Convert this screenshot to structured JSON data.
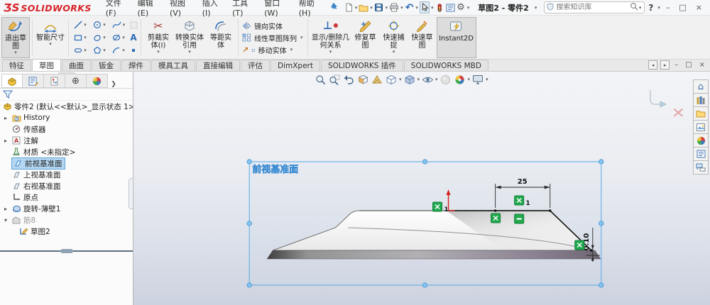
{
  "titlebar": {
    "logo_mark": "ƷS",
    "logo_text": "SOLIDWORKS",
    "menus": [
      {
        "label": "文件(F)"
      },
      {
        "label": "编辑(E)"
      },
      {
        "label": "视图(V)"
      },
      {
        "label": "插入(I)"
      },
      {
        "label": "工具(T)"
      },
      {
        "label": "窗口(W)"
      },
      {
        "label": "帮助(H)"
      }
    ],
    "doc_title": "草图2 - 零件2",
    "search_placeholder": "搜索知识库",
    "help_label": "?",
    "win": {
      "min": "–",
      "max": "□",
      "close": "×"
    }
  },
  "ribbon": {
    "exit_sketch": "退出草图",
    "smart_dimension": "智能尺寸",
    "text_tool": "A",
    "trim": "剪裁实体(I)",
    "convert": "转换实体引用",
    "offset": "等距实体",
    "mirror": "镜向实体",
    "linear_pattern": "线性草图阵列",
    "move": "移动实体",
    "relations": "显示/删除几何关系",
    "repair": "修复草图",
    "quick_snaps": "快速捕捉",
    "rapid_sketch": "快速草图",
    "instant2d": "Instant2D"
  },
  "tabs": [
    {
      "label": "特征"
    },
    {
      "label": "草图"
    },
    {
      "label": "曲面"
    },
    {
      "label": "钣金"
    },
    {
      "label": "焊件"
    },
    {
      "label": "模具工具"
    },
    {
      "label": "直接编辑"
    },
    {
      "label": "评估"
    },
    {
      "label": "DimXpert"
    },
    {
      "label": "SOLIDWORKS 插件"
    },
    {
      "label": "SOLIDWORKS MBD"
    }
  ],
  "docwin": {
    "prev": "◂",
    "next": "▸",
    "min": "–",
    "max": "□",
    "close": "×"
  },
  "tree": {
    "root": "零件2 (默认<<默认>_显示状态 1>)",
    "items": [
      {
        "label": "History",
        "arrow": "▸"
      },
      {
        "label": "传感器",
        "arrow": ""
      },
      {
        "label": "注解",
        "arrow": "▸"
      },
      {
        "label": "材质 <未指定>",
        "arrow": ""
      },
      {
        "label": "前视基准面",
        "arrow": ""
      },
      {
        "label": "上视基准面",
        "arrow": ""
      },
      {
        "label": "右视基准面",
        "arrow": ""
      },
      {
        "label": "原点",
        "arrow": ""
      },
      {
        "label": "旋转-薄壁1",
        "arrow": "▸"
      },
      {
        "label": "筋8",
        "arrow": "▾"
      },
      {
        "label": "草图2",
        "arrow": ""
      }
    ]
  },
  "viewport": {
    "plane_label": "前视基准面",
    "dim_width": "25",
    "dim_offset": "0.10",
    "relation_badge_1": "1",
    "relation_badge_2": "1"
  }
}
